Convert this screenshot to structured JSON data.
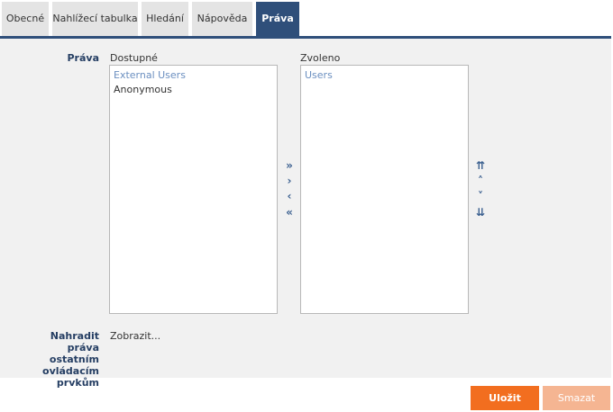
{
  "tabs": [
    {
      "label": "Obecné",
      "active": false
    },
    {
      "label": "Nahlížecí tabulka",
      "active": false
    },
    {
      "label": "Hledání",
      "active": false
    },
    {
      "label": "Nápověda",
      "active": false
    },
    {
      "label": "Práva",
      "active": true
    }
  ],
  "rights": {
    "label": "Práva",
    "available_label": "Dostupné",
    "selected_label": "Zvoleno",
    "available_items": [
      "External Users",
      "Anonymous"
    ],
    "selected_items": [
      "Users"
    ]
  },
  "transfer": {
    "add_all": "»",
    "add_one": "›",
    "remove_one": "‹",
    "remove_all": "«"
  },
  "order": {
    "top": "⇈",
    "up": "˄",
    "down": "˅",
    "bottom": "⇊"
  },
  "replace_rights": {
    "label": "Nahradit práva ostatním ovládacím prvkům",
    "label_lines": [
      "Nahradit práva",
      "ostatním",
      "ovládacím",
      "prvkům"
    ],
    "link": "Zobrazit..."
  },
  "buttons": {
    "save": "Uložit",
    "delete": "Smazat"
  },
  "colors": {
    "accent": "#2f4f7a",
    "save": "#f26e1f",
    "delete_disabled": "#f5b592",
    "muted_item": "#6b8fc0"
  }
}
